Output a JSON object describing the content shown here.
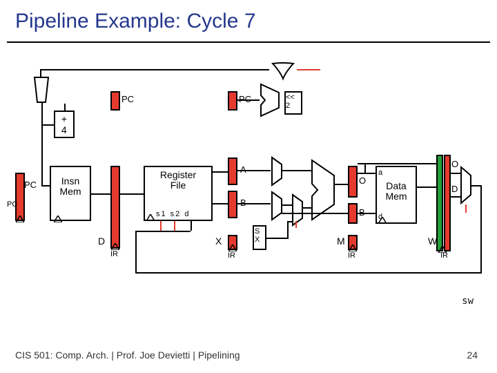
{
  "title": "Pipeline Example: Cycle 7",
  "footer": "CIS 501: Comp. Arch.  |  Prof. Joe Devietti  |  Pipelining",
  "page_num": "24",
  "sw_label": "sw",
  "blocks": {
    "imem": "Insn\nMem",
    "regfile": "Register\nFile",
    "regfile_ports": "s1 s2  d",
    "dmem_top": "a",
    "dmem_mid": "Data\nMem",
    "dmem_bot": "d",
    "plus4": "+\n4",
    "shl2": "<<\n2"
  },
  "ports": {
    "pc_out": "PC",
    "pipe_pc1": "PC",
    "pipe_pc2": "PC",
    "A": "A",
    "B": "B",
    "O1": "O",
    "O2": "O",
    "Dport": "D",
    "X": "X",
    "SX": "S\nX",
    "B2": "B"
  },
  "stage_letters": {
    "D": "D",
    "M": "M",
    "W": "W"
  },
  "ir_labels": {
    "ir1": "IR",
    "ir2": "IR",
    "ir3": "IR",
    "ir4": "IR"
  },
  "pc_label": "PC"
}
